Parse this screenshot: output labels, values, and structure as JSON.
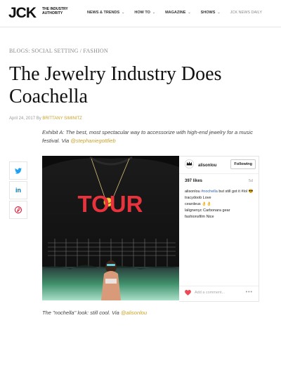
{
  "header": {
    "logo": "JCK",
    "tagline": "THE INDUSTRY AUTHORITY",
    "nav": [
      {
        "label": "NEWS & TRENDS",
        "has_dropdown": true
      },
      {
        "label": "HOW TO",
        "has_dropdown": true
      },
      {
        "label": "MAGAZINE",
        "has_dropdown": true
      },
      {
        "label": "SHOWS",
        "has_dropdown": true
      },
      {
        "label": "JCK NEWS DAILY",
        "has_dropdown": false
      }
    ]
  },
  "article": {
    "breadcrumb": "BLOGS: SOCIAL SETTING / FASHION",
    "title": "The Jewelry Industry Does Coachella",
    "date": "April 24, 2017",
    "by": "By",
    "author": "BRITTANY SIMINITZ",
    "caption1_text": "Exhibit A: The best, most spectacular way to accessorize with high-end jewelry for a music festival. Via ",
    "caption1_link": "@stephaniegottlieb",
    "caption2_text": "The \"nochella\" look: still cool. Via ",
    "caption2_link": "@alisonlou",
    "shirt_text": "TOUR"
  },
  "share": [
    {
      "icon": "twitter-icon",
      "color": "#1da1f2"
    },
    {
      "icon": "linkedin-icon",
      "color": "#0077b5"
    },
    {
      "icon": "pinterest-icon",
      "color": "#e60023"
    }
  ],
  "instagram": {
    "username": "alisonlou",
    "follow_label": "Following",
    "likes": "397 likes",
    "age": "5d",
    "comments": [
      {
        "user": "alisonlou",
        "tag": "#nochella",
        "text": " but still got it #lol 😎"
      },
      {
        "user": "tracydoob",
        "tag": "",
        "text": " Love"
      },
      {
        "user": "ceardeus",
        "tag": "",
        "text": " 👌👌"
      },
      {
        "user": "lalignenyc",
        "tag": "",
        "text": " Carbonara gear"
      },
      {
        "user": "fashionsfilm",
        "tag": "",
        "text": " Nice"
      }
    ],
    "add_comment_placeholder": "Add a comment...",
    "more_label": "•••"
  },
  "colors": {
    "accent_gold": "#c9a227",
    "shirt_text": "#e8323c",
    "heart": "#ed4956"
  }
}
